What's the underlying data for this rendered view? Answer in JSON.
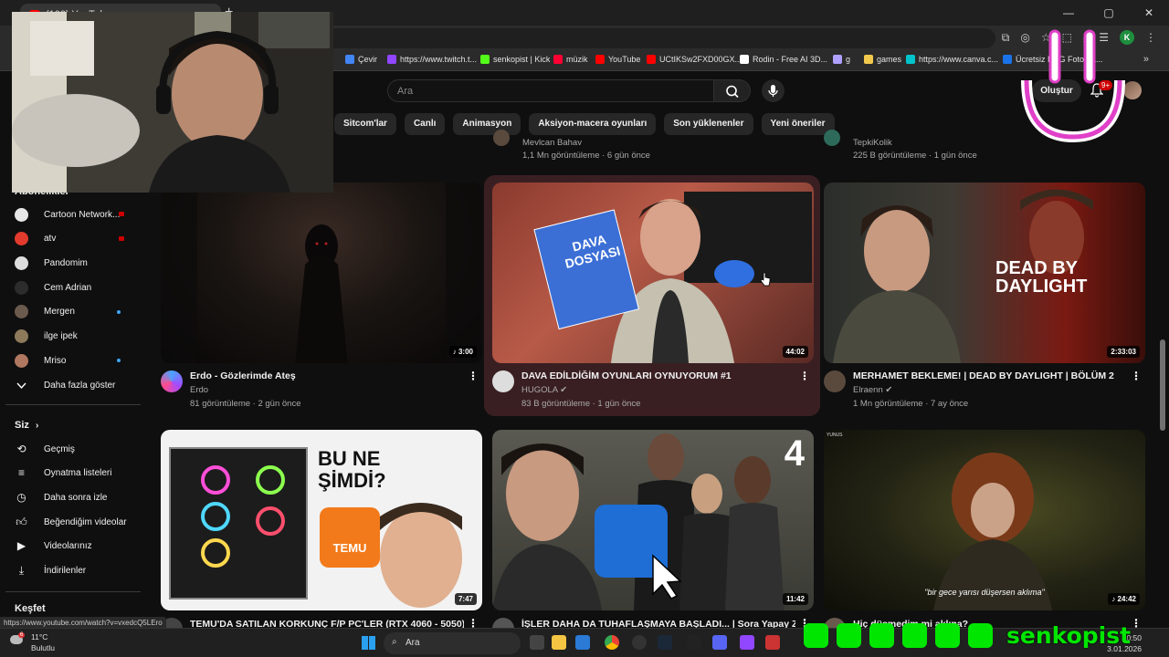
{
  "browser": {
    "tab_title": "(100) YouTube",
    "bookmarks": [
      {
        "label": "Çevir",
        "color": "#4285f4"
      },
      {
        "label": "https://www.twitch.t...",
        "color": "#9146ff"
      },
      {
        "label": "senkopist | Kick",
        "color": "#53fc18"
      },
      {
        "label": "müzik",
        "color": "#ff0033"
      },
      {
        "label": "YouTube",
        "color": "#ff0000"
      },
      {
        "label": "UCtIKSw2FXD00GX...",
        "color": "#ff0000"
      },
      {
        "label": "Rodin - Free AI 3D...",
        "color": "#ffffff"
      },
      {
        "label": "g",
        "color": "#b0a0ff"
      },
      {
        "label": "games",
        "color": "#f2c94c"
      },
      {
        "label": "https://www.canva.c...",
        "color": "#00c4cc"
      },
      {
        "label": "Ücretsiz PNG Fotoğra...",
        "color": "#1a73e8"
      }
    ],
    "profile_letter": "K",
    "status_url": "https://www.youtube.com/watch?v=vxedcQ5LEro"
  },
  "youtube": {
    "search_placeholder": "Ara",
    "create_label": "Oluştur",
    "notification_count": "9+",
    "chips": [
      "Sitcom'lar",
      "Canlı",
      "Animasyon",
      "Aksiyon-macera oyunları",
      "Son yüklenenler",
      "Yeni öneriler"
    ],
    "sidebar": {
      "subscriptions_heading": "Abonelikler",
      "channels": [
        {
          "name": "Cartoon Network...",
          "live": true,
          "new": false,
          "color": "#e6e6e6"
        },
        {
          "name": "atv",
          "live": true,
          "new": false,
          "color": "#e23b2e"
        },
        {
          "name": "Pandomim",
          "live": false,
          "new": false,
          "color": "#dddddd"
        },
        {
          "name": "Cem Adrian",
          "live": false,
          "new": false,
          "color": "#2c2c2c"
        },
        {
          "name": "Mergen",
          "live": false,
          "new": true,
          "color": "#6b5a4e"
        },
        {
          "name": "ilge ipek",
          "live": false,
          "new": false,
          "color": "#8c7a5a"
        },
        {
          "name": "Mriso",
          "live": false,
          "new": true,
          "color": "#b07860"
        }
      ],
      "show_more": "Daha fazla göster",
      "you_heading": "Siz",
      "you_items": [
        "Geçmiş",
        "Oynatma listeleri",
        "Daha sonra izle",
        "Beğendiğim videolar",
        "Videolarınız",
        "İndirilenler"
      ],
      "explore_heading": "Keşfet"
    },
    "top_row_partial": [
      {
        "channel": "Mevlcan Bahav",
        "meta": "1,1 Mn görüntüleme · 6 gün önce"
      },
      {
        "channel": "TepkiKolik",
        "meta": "225 B görüntüleme · 1 gün önce"
      }
    ],
    "videos": [
      {
        "title": "Erdo  -  Gözlerimde Ateş",
        "channel": "Erdo",
        "verified": false,
        "meta": "81 görüntüleme · 2 gün önce",
        "duration": "3:00",
        "thumb_text": ""
      },
      {
        "title": "DAVA EDİLDİĞİM OYUNLARI OYNUYORUM #1",
        "channel": "HUGOLA",
        "verified": true,
        "meta": "83 B görüntüleme · 1 gün önce",
        "duration": "44:02",
        "thumb_text": "DAVA DOSYASI"
      },
      {
        "title": "MERHAMET BEKLEME! | DEAD BY DAYLIGHT | BÖLÜM 2",
        "channel": "Elraenn",
        "verified": true,
        "meta": "1 Mn görüntüleme · 7 ay önce",
        "duration": "2:33:03",
        "thumb_text": "DEAD BY DAYLIGHT"
      },
      {
        "title": "TEMU'DA SATILAN KORKUNÇ F/P PC'LER (RTX 4060 - 5050)",
        "channel": "",
        "verified": false,
        "meta": "",
        "duration": "7:47",
        "thumb_text": "BU NE ŞİMDİ?",
        "thumb_badge": "TEMU"
      },
      {
        "title": "İŞLER DAHA DA TUHAFLAŞMAYA BAŞLADI... | Sora Yapay Zeka",
        "channel": "",
        "verified": false,
        "meta": "",
        "duration": "11:42",
        "thumb_text": "4"
      },
      {
        "title": "Hiç düşmedim mi aklına?",
        "channel": "",
        "verified": false,
        "meta": "",
        "duration": "24:42",
        "thumb_text": "\"bir gece yarısı düşersen aklıma\"",
        "thumb_corner": "YUNUS"
      }
    ]
  },
  "overlay": {
    "handle": "senkopist",
    "social_icons": [
      "instagram-icon",
      "tiktok-icon",
      "kick-icon",
      "youtube-icon",
      "x-icon",
      "snapchat-icon"
    ]
  },
  "taskbar": {
    "temp": "11°C",
    "weather": "Bulutlu",
    "weather_badge": "6",
    "search": "Ara",
    "time": "20:50",
    "date": "3.01.2026"
  }
}
